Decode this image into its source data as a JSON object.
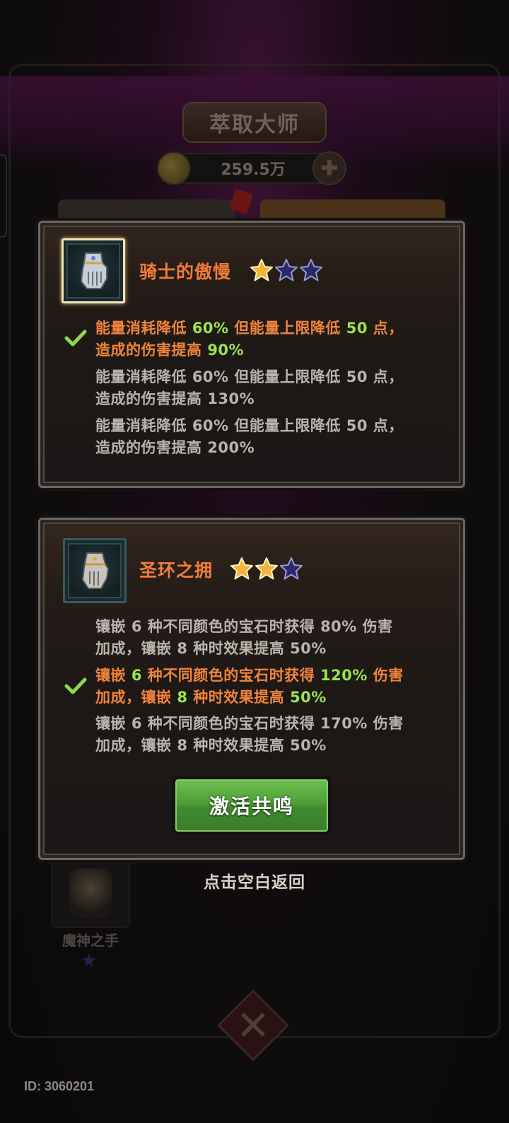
{
  "background": {
    "title": "萃取大师",
    "currency": "259.5万",
    "slot_label": "魔神之手"
  },
  "panels": [
    {
      "name": "骑士的傲慢",
      "stars": {
        "filled": 1,
        "total": 3
      },
      "options": [
        {
          "line1": [
            "能量消耗降低 ",
            {
              "n": "60%"
            },
            " 但能量上限降低 ",
            {
              "n": "50"
            },
            " 点，"
          ],
          "line2": [
            "造成的伤害提高 ",
            {
              "n": "90%"
            }
          ],
          "active": true
        },
        {
          "line1": [
            "能量消耗降低 ",
            {
              "n": "60%"
            },
            " 但能量上限降低 ",
            {
              "n": "50"
            },
            " 点，"
          ],
          "line2": [
            "造成的伤害提高 ",
            {
              "n": "130%"
            }
          ],
          "active": false
        },
        {
          "line1": [
            "能量消耗降低 ",
            {
              "n": "60%"
            },
            " 但能量上限降低 ",
            {
              "n": "50"
            },
            " 点，"
          ],
          "line2": [
            "造成的伤害提高 ",
            {
              "n": "200%"
            }
          ],
          "active": false
        }
      ]
    },
    {
      "name": "圣环之拥",
      "stars": {
        "filled": 2,
        "total": 3
      },
      "options": [
        {
          "line1": [
            "镶嵌 ",
            {
              "n": "6"
            },
            " 种不同颜色的宝石时获得 ",
            {
              "n": "80%"
            },
            " 伤害"
          ],
          "line2": [
            "加成，镶嵌 ",
            {
              "n": "8"
            },
            " 种时效果提高 ",
            {
              "n": "50%"
            }
          ],
          "active": false
        },
        {
          "line1": [
            "镶嵌 ",
            {
              "n": "6"
            },
            " 种不同颜色的宝石时获得 ",
            {
              "n": "120%"
            },
            " 伤害"
          ],
          "line2": [
            "加成，镶嵌 ",
            {
              "n": "8"
            },
            " 种时效果提高 ",
            {
              "n": "50%"
            }
          ],
          "active": true
        },
        {
          "line1": [
            "镶嵌 ",
            {
              "n": "6"
            },
            " 种不同颜色的宝石时获得 ",
            {
              "n": "170%"
            },
            " 伤害"
          ],
          "line2": [
            "加成，镶嵌 ",
            {
              "n": "8"
            },
            " 种时效果提高 ",
            {
              "n": "50%"
            }
          ],
          "active": false
        }
      ],
      "button_label": "激活共鸣"
    }
  ],
  "hint": "点击空白返回",
  "id_label": "ID: 3060201",
  "colors": {
    "item_name": "#f07c3a",
    "active_text": "#f0843c",
    "active_number": "#9be34f",
    "inactive_text": "#bab4ac",
    "star_gold": "#f0b43a",
    "star_empty": "#2a2a6a",
    "button_green": "#4e9e38"
  },
  "icons": {
    "item_1": "gauntlet-icon",
    "item_2": "gauntlet-icon",
    "check": "checkmark-icon",
    "star": "star-icon"
  }
}
